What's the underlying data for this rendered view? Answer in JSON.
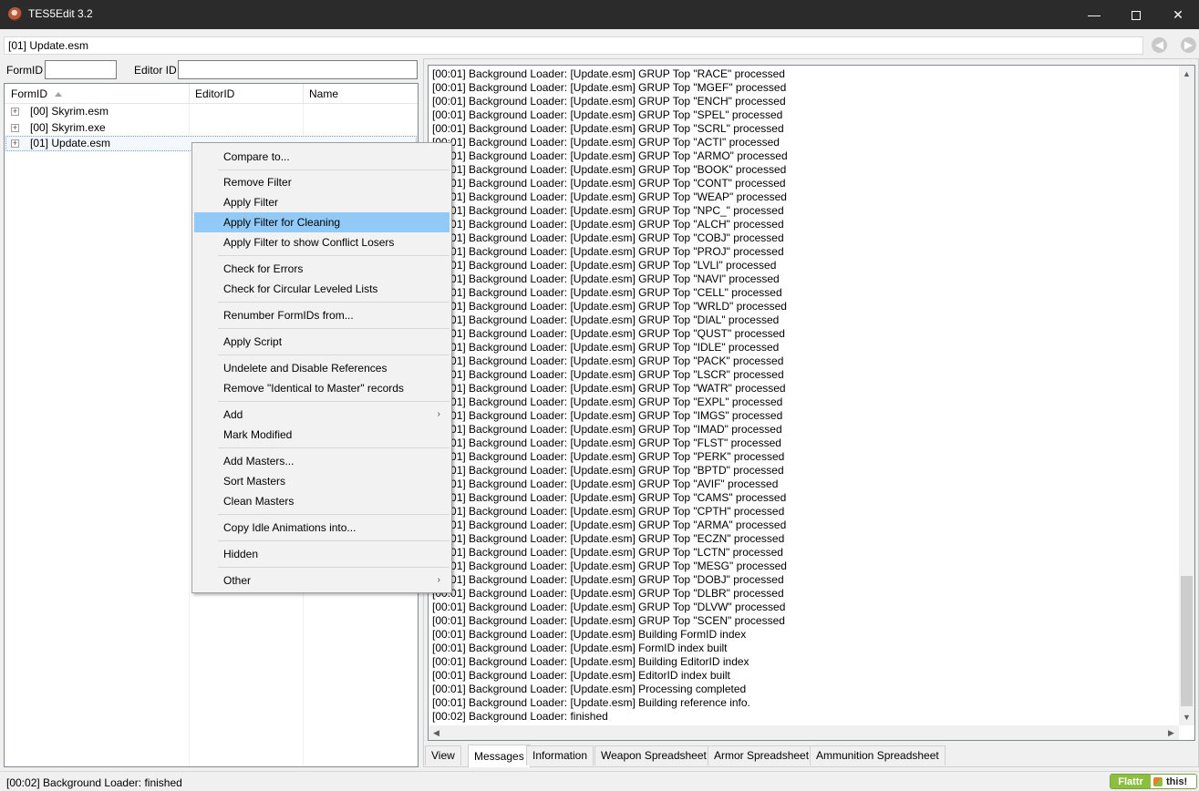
{
  "window": {
    "title": "TES5Edit 3.2",
    "minimize_glyph": "—",
    "close_glyph": "✕"
  },
  "filebar": {
    "value": "[01] Update.esm",
    "back_glyph": "◀",
    "forward_glyph": "▶"
  },
  "filters": {
    "formid_label": "FormID",
    "editorid_label": "Editor ID",
    "formid_value": "",
    "editorid_value": ""
  },
  "tree": {
    "columns": [
      "FormID",
      "EditorID",
      "Name"
    ],
    "rows": [
      "[00] Skyrim.esm",
      "[00] Skyrim.exe",
      "[01] Update.esm"
    ],
    "expander_glyph": "+"
  },
  "context_menu": {
    "items": [
      "Compare to...",
      "Remove Filter",
      "Apply Filter",
      "Apply Filter for Cleaning",
      "Apply Filter to show Conflict Losers",
      "Check for Errors",
      "Check for Circular Leveled Lists",
      "Renumber FormIDs from...",
      "Apply Script",
      "Undelete and Disable References",
      "Remove \"Identical to Master\" records",
      "Add",
      "Mark Modified",
      "Add Masters...",
      "Sort Masters",
      "Clean Masters",
      "Copy Idle Animations into...",
      "Hidden",
      "Other"
    ],
    "submenu_glyph": "›"
  },
  "messages": {
    "lines": [
      "[00:01] Background Loader: [Update.esm] GRUP Top \"RACE\" processed",
      "[00:01] Background Loader: [Update.esm] GRUP Top \"MGEF\" processed",
      "[00:01] Background Loader: [Update.esm] GRUP Top \"ENCH\" processed",
      "[00:01] Background Loader: [Update.esm] GRUP Top \"SPEL\" processed",
      "[00:01] Background Loader: [Update.esm] GRUP Top \"SCRL\" processed",
      "[00:01] Background Loader: [Update.esm] GRUP Top \"ACTI\" processed",
      "[00:01] Background Loader: [Update.esm] GRUP Top \"ARMO\" processed",
      "[00:01] Background Loader: [Update.esm] GRUP Top \"BOOK\" processed",
      "[00:01] Background Loader: [Update.esm] GRUP Top \"CONT\" processed",
      "[00:01] Background Loader: [Update.esm] GRUP Top \"WEAP\" processed",
      "[00:01] Background Loader: [Update.esm] GRUP Top \"NPC_\" processed",
      "[00:01] Background Loader: [Update.esm] GRUP Top \"ALCH\" processed",
      "[00:01] Background Loader: [Update.esm] GRUP Top \"COBJ\" processed",
      "[00:01] Background Loader: [Update.esm] GRUP Top \"PROJ\" processed",
      "[00:01] Background Loader: [Update.esm] GRUP Top \"LVLI\" processed",
      "[00:01] Background Loader: [Update.esm] GRUP Top \"NAVI\" processed",
      "[00:01] Background Loader: [Update.esm] GRUP Top \"CELL\" processed",
      "[00:01] Background Loader: [Update.esm] GRUP Top \"WRLD\" processed",
      "[00:01] Background Loader: [Update.esm] GRUP Top \"DIAL\" processed",
      "[00:01] Background Loader: [Update.esm] GRUP Top \"QUST\" processed",
      "[00:01] Background Loader: [Update.esm] GRUP Top \"IDLE\" processed",
      "[00:01] Background Loader: [Update.esm] GRUP Top \"PACK\" processed",
      "[00:01] Background Loader: [Update.esm] GRUP Top \"LSCR\" processed",
      "[00:01] Background Loader: [Update.esm] GRUP Top \"WATR\" processed",
      "[00:01] Background Loader: [Update.esm] GRUP Top \"EXPL\" processed",
      "[00:01] Background Loader: [Update.esm] GRUP Top \"IMGS\" processed",
      "[00:01] Background Loader: [Update.esm] GRUP Top \"IMAD\" processed",
      "[00:01] Background Loader: [Update.esm] GRUP Top \"FLST\" processed",
      "[00:01] Background Loader: [Update.esm] GRUP Top \"PERK\" processed",
      "[00:01] Background Loader: [Update.esm] GRUP Top \"BPTD\" processed",
      "[00:01] Background Loader: [Update.esm] GRUP Top \"AVIF\" processed",
      "[00:01] Background Loader: [Update.esm] GRUP Top \"CAMS\" processed",
      "[00:01] Background Loader: [Update.esm] GRUP Top \"CPTH\" processed",
      "[00:01] Background Loader: [Update.esm] GRUP Top \"ARMA\" processed",
      "[00:01] Background Loader: [Update.esm] GRUP Top \"ECZN\" processed",
      "[00:01] Background Loader: [Update.esm] GRUP Top \"LCTN\" processed",
      "[00:01] Background Loader: [Update.esm] GRUP Top \"MESG\" processed",
      "[00:01] Background Loader: [Update.esm] GRUP Top \"DOBJ\" processed",
      "[00:01] Background Loader: [Update.esm] GRUP Top \"DLBR\" processed",
      "[00:01] Background Loader: [Update.esm] GRUP Top \"DLVW\" processed",
      "[00:01] Background Loader: [Update.esm] GRUP Top \"SCEN\" processed",
      "[00:01] Background Loader: [Update.esm] Building FormID index",
      "[00:01] Background Loader: [Update.esm] FormID index built",
      "[00:01] Background Loader: [Update.esm] Building EditorID index",
      "[00:01] Background Loader: [Update.esm] EditorID index built",
      "[00:01] Background Loader: [Update.esm] Processing completed",
      "[00:01] Background Loader: [Update.esm] Building reference info.",
      "[00:02] Background Loader: finished"
    ],
    "scroll_up_glyph": "▲",
    "scroll_down_glyph": "▼",
    "scroll_left_glyph": "◀",
    "scroll_right_glyph": "▶"
  },
  "tabs": [
    "View",
    "Messages",
    "Information",
    "Weapon Spreadsheet",
    "Armor Spreadsheet",
    "Ammunition Spreadsheet"
  ],
  "status": {
    "text": "[00:02] Background Loader: finished"
  },
  "flattr": {
    "left_label": "Flattr",
    "right_label": "this!"
  }
}
